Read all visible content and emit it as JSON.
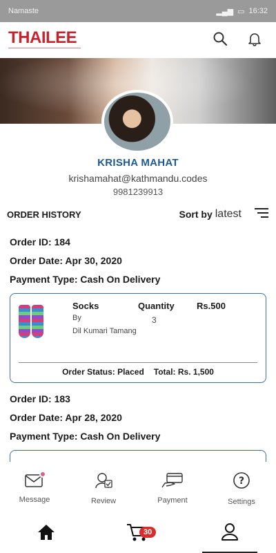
{
  "status_bar": {
    "carrier": "Namaste",
    "time": "16:32"
  },
  "header": {
    "logo_text": "THAILEE"
  },
  "profile": {
    "name": "KRISHA MAHAT",
    "email": "krishamahat@kathmandu.codes",
    "phone": "9981239913"
  },
  "order_history": {
    "title": "ORDER HISTORY",
    "sort_label": "Sort by",
    "sort_value": "latest"
  },
  "orders": [
    {
      "id_line": "Order ID: 184",
      "date_line": "Order Date: Apr 30, 2020",
      "payment_line": "Payment Type: Cash On Delivery",
      "product_name": "Socks",
      "by_label": "By",
      "seller": "Dil Kumari Tamang",
      "quantity_label": "Quantity",
      "quantity": "3",
      "price": "Rs.500",
      "status": "Order Status: Placed",
      "total": "Total: Rs. 1,500"
    },
    {
      "id_line": "Order ID: 183",
      "date_line": "Order Date: Apr 28, 2020",
      "payment_line": "Payment Type: Cash On Delivery"
    }
  ],
  "quick_nav": [
    {
      "label": "Message",
      "icon": "message-icon"
    },
    {
      "label": "Review",
      "icon": "review-icon"
    },
    {
      "label": "Payment",
      "icon": "payment-icon"
    },
    {
      "label": "Settings",
      "icon": "settings-icon"
    }
  ],
  "tab_bar": {
    "cart_count": "30"
  },
  "colors": {
    "brand_red": "#c8232c",
    "accent_blue": "#1e5a8f",
    "badge_red": "#d92d2d"
  }
}
